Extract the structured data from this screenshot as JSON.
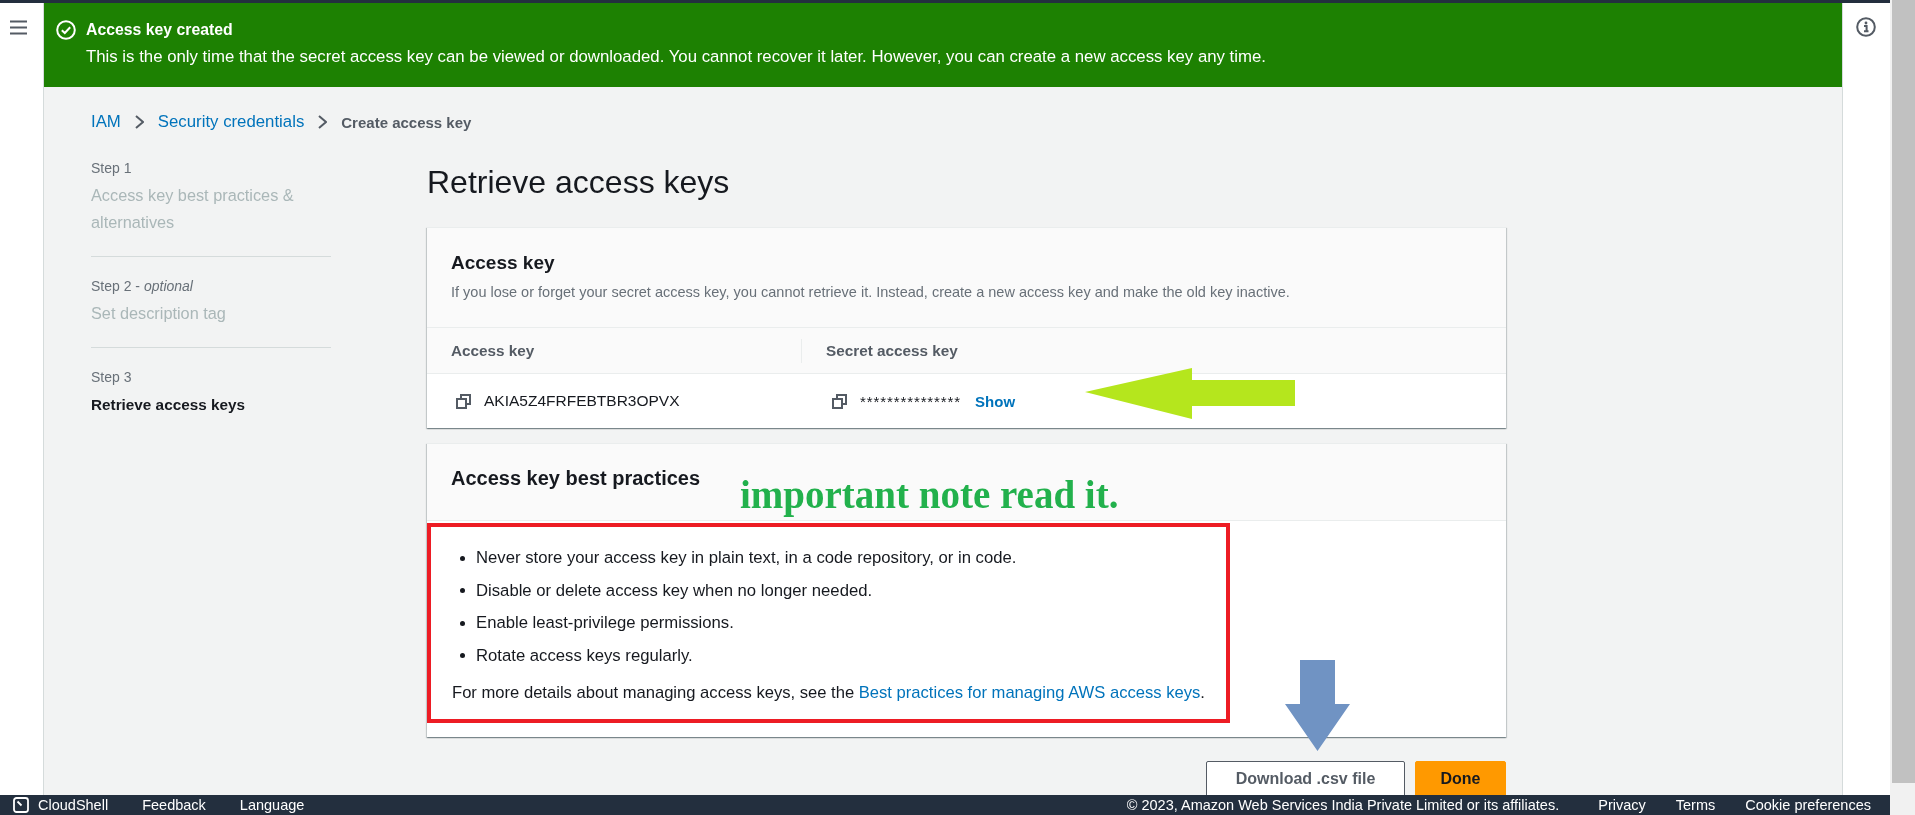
{
  "banner": {
    "title": "Access key created",
    "message": "This is the only time that the secret access key can be viewed or downloaded. You cannot recover it later. However, you can create a new access key any time."
  },
  "breadcrumb": [
    {
      "label": "IAM",
      "kind": "link"
    },
    {
      "label": "Security credentials",
      "kind": "link"
    },
    {
      "label": "Create access key",
      "kind": "current"
    }
  ],
  "steps": [
    {
      "label": "Step 1",
      "title": "Access key best practices & alternatives",
      "selected": false
    },
    {
      "label": "Step 2 - *optional*",
      "title": "Set description tag",
      "selected": false
    },
    {
      "label": "Step 3",
      "title": "Retrieve access keys",
      "selected": true
    }
  ],
  "page_title": "Retrieve access keys",
  "access_key_card": {
    "title": "Access key",
    "description": "If you lose or forget your secret access key, you cannot retrieve it. Instead, create a new access key and make the old key inactive.",
    "columns": [
      "Access key",
      "Secret access key"
    ],
    "access_key": "AKIA5Z4FRFEBTBR3OPVX",
    "secret_access_key": "***************",
    "show_link": "Show"
  },
  "best_practices_card": {
    "title": "Access key best practices",
    "items": [
      "Never store your access key in plain text, in a code repository, or in code.",
      "Disable or delete access key when no longer needed.",
      "Enable least-privilege permissions.",
      "Rotate access keys regularly."
    ],
    "more_details": "For more details about managing access keys, see the ",
    "link": "Best practices for managing AWS access keys",
    "more_details_end": "."
  },
  "annotation": {
    "note": "important note read it."
  },
  "actions": [
    {
      "label": "Download .csv file",
      "kind": "secondary"
    },
    {
      "label": "Done",
      "kind": "primary"
    }
  ],
  "footer": {
    "cloudshell": "CloudShell",
    "left_links": [
      "Feedback",
      "Language"
    ],
    "copyright": "© 2023, Amazon Web Services India Private Limited or its affiliates.",
    "right_links": [
      "Privacy",
      "Terms",
      "Cookie preferences"
    ]
  }
}
